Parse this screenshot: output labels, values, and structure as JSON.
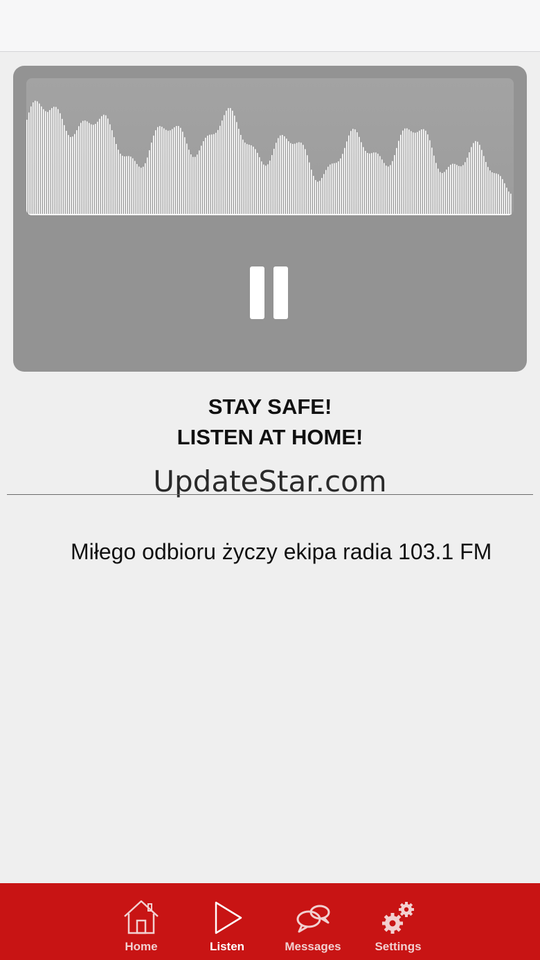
{
  "player": {
    "state": "playing",
    "pause_icon": "pause-icon"
  },
  "main": {
    "slogan_line1": "STAY SAFE!",
    "slogan_line2": "LISTEN AT HOME!",
    "watermark": "UpdateStar.com",
    "ticker": "Miłego odbioru życzy ekipa  radia 103.1 FM"
  },
  "tabs": [
    {
      "label": "Home",
      "icon": "home-icon",
      "active": false
    },
    {
      "label": "Listen",
      "icon": "play-icon",
      "active": true
    },
    {
      "label": "Messages",
      "icon": "chat-bubbles-icon",
      "active": false
    },
    {
      "label": "Settings",
      "icon": "gears-icon",
      "active": false
    }
  ],
  "colors": {
    "tab_bar": "#c81414",
    "player_card": "#939393",
    "background": "#efefef"
  }
}
